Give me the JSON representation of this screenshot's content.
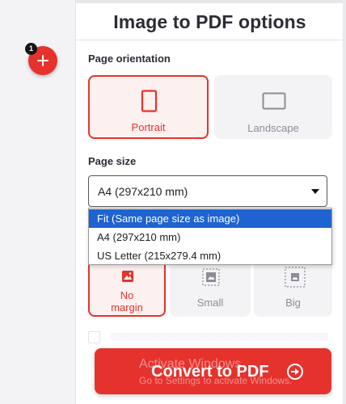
{
  "sidebar": {
    "add_button_icon": "plus-icon",
    "file_count": "1"
  },
  "panel": {
    "title": "Image to PDF options"
  },
  "orientation": {
    "label": "Page orientation",
    "options": [
      {
        "label": "Portrait",
        "icon": "portrait-page-icon",
        "selected": true
      },
      {
        "label": "Landscape",
        "icon": "landscape-page-icon",
        "selected": false
      }
    ]
  },
  "page_size": {
    "label": "Page size",
    "selected_value": "A4 (297x210 mm)",
    "options": [
      {
        "label": "Fit (Same page size as image)",
        "highlighted": true
      },
      {
        "label": "A4 (297x210 mm)",
        "highlighted": false
      },
      {
        "label": "US Letter (215x279.4 mm)",
        "highlighted": false
      }
    ]
  },
  "margin": {
    "options": [
      {
        "label": "No margin",
        "line1": "No",
        "line2": "margin",
        "icon": "no-margin-icon",
        "selected": true
      },
      {
        "label": "Small",
        "icon": "small-margin-icon",
        "selected": false
      },
      {
        "label": "Big",
        "icon": "big-margin-icon",
        "selected": false
      }
    ]
  },
  "convert_button": {
    "label": "Convert to PDF",
    "icon": "arrow-right-circle-icon"
  },
  "os_watermark": {
    "title": "Activate Windows",
    "subtitle": "Go to Settings to activate Windows."
  },
  "colors": {
    "accent": "#e5322d",
    "selected_bg": "#fdf1ef",
    "card_bg": "#f3f3f6",
    "highlight": "#1e63d1"
  }
}
